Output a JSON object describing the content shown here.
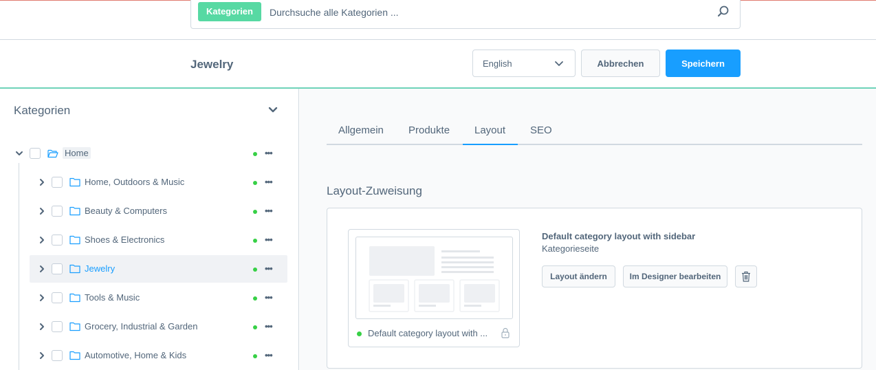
{
  "search": {
    "tag": "Kategorien",
    "placeholder": "Durchsuche alle Kategorien ..."
  },
  "header": {
    "title": "Jewelry",
    "language": "English",
    "cancel_label": "Abbrechen",
    "save_label": "Speichern"
  },
  "sidebar": {
    "title": "Kategorien",
    "tree": [
      {
        "label": "Home",
        "root": true,
        "expanded": true,
        "active": true
      },
      {
        "label": "Home, Outdoors & Music",
        "active": true
      },
      {
        "label": "Beauty & Computers",
        "active": true
      },
      {
        "label": "Shoes & Electronics",
        "active": true
      },
      {
        "label": "Jewelry",
        "active": true,
        "selected": true
      },
      {
        "label": "Tools & Music",
        "active": true
      },
      {
        "label": "Grocery, Industrial & Garden",
        "active": true
      },
      {
        "label": "Automotive, Home & Kids",
        "active": true
      }
    ],
    "more_label": "•••"
  },
  "tabs": [
    {
      "label": "Allgemein"
    },
    {
      "label": "Produkte"
    },
    {
      "label": "Layout",
      "active": true
    },
    {
      "label": "SEO"
    }
  ],
  "layout_section": {
    "title": "Layout-Zuweisung",
    "preview_caption": "Default category layout with ...",
    "layout_name": "Default category layout with sidebar",
    "layout_type": "Kategorieseite",
    "change_label": "Layout ändern",
    "designer_label": "Im Designer bearbeiten"
  },
  "colors": {
    "accent": "#189eff",
    "success_tag": "#57d9a3",
    "status_active": "#37d046",
    "header_border": "#6ed3b9"
  }
}
